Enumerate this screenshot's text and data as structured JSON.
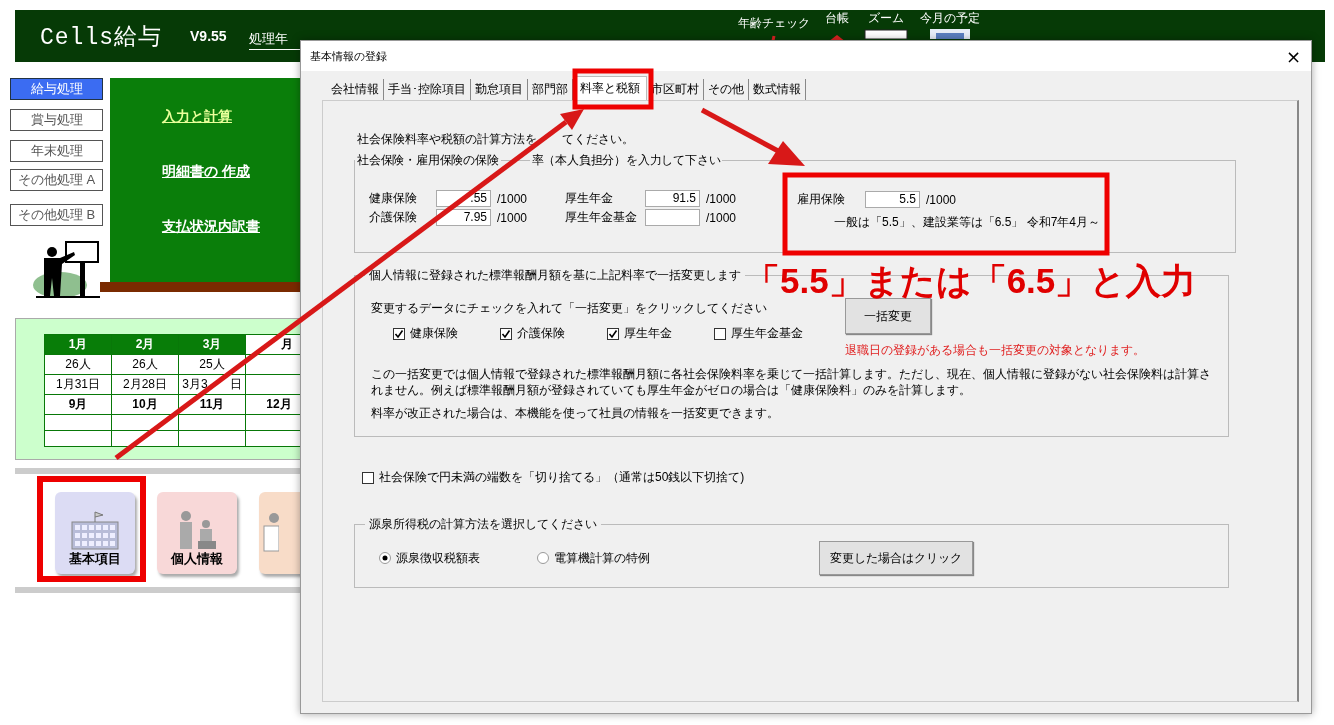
{
  "app": {
    "title": "Cells給与",
    "version": "V9.55",
    "year_label": "処理年",
    "toolbar": [
      {
        "label": "年齢チェック"
      },
      {
        "label": "台帳"
      },
      {
        "label": "ズーム"
      },
      {
        "label": "今月の予定"
      }
    ],
    "menu": [
      {
        "label": "給与処理",
        "selected": true
      },
      {
        "label": "賞与処理",
        "selected": false
      },
      {
        "label": "年末処理",
        "selected": false
      },
      {
        "label": "その他処理 A",
        "selected": false
      },
      {
        "label": "その他処理 B",
        "selected": false
      }
    ],
    "links": [
      {
        "label": "入力と計算",
        "highlight": true
      },
      {
        "label": "明細書の 作成",
        "highlight": false
      },
      {
        "label": "支払状況内訳書",
        "highlight": false
      }
    ],
    "calendar": {
      "header": [
        "1月",
        "2月",
        "3月",
        "月"
      ],
      "rows": [
        [
          "26人",
          "26人",
          "25人",
          ""
        ],
        [
          "1月31日",
          "2月28日",
          [
            "3月3",
            "日"
          ],
          ""
        ]
      ],
      "header_2": [
        "9月",
        "10月",
        "11月",
        "12月"
      ]
    },
    "launchers": [
      {
        "label": "基本項目",
        "kind": "building"
      },
      {
        "label": "個人情報",
        "kind": "people"
      },
      {
        "kind": "worker"
      }
    ]
  },
  "dialog": {
    "title": "基本情報の登録",
    "close": "×",
    "tabs": [
      {
        "label": "会社情報",
        "selected": false
      },
      {
        "label": "手当･控除項目",
        "selected": false
      },
      {
        "label": "勤怠項目",
        "selected": false
      },
      {
        "label": "部門部",
        "selected": false
      },
      {
        "label": "料率と税額",
        "selected": true
      },
      {
        "label": "市区町村",
        "selected": false
      },
      {
        "label": "その他",
        "selected": false
      },
      {
        "label": "数式情報",
        "selected": false
      }
    ],
    "instruction": [
      "社会保険料率や税額の計算方法を",
      "てください。"
    ],
    "rates_group": {
      "legend": [
        "社会保険・雇用保険の保険",
        "率（本人負担分）を入力して下さい"
      ],
      "fields": [
        {
          "label": "健康保険",
          "value": ".55",
          "unit": "/1000"
        },
        {
          "label": "介護保険",
          "value": "7.95",
          "unit": "/1000"
        },
        {
          "label": "厚生年金",
          "value": "91.5",
          "unit": "/1000"
        },
        {
          "label": "厚生年金基金",
          "unit": "/1000"
        }
      ],
      "employment": {
        "label": "雇用保険",
        "value": "5.5",
        "unit": "/1000",
        "note": "一般は「5.5」、建設業等は「6.5」 令和7年4月～"
      }
    },
    "bulk_group": {
      "legend": "個人情報に登録された標準報酬月額を基に上記料率で一括変更します",
      "instruction": "変更するデータにチェックを入れて「一括変更」をクリックしてください",
      "checkboxes": [
        {
          "label": "健康保険",
          "checked": true
        },
        {
          "label": "介護保険",
          "checked": true
        },
        {
          "label": "厚生年金",
          "checked": true
        },
        {
          "label": "厚生年金基金",
          "checked": false
        }
      ],
      "button": "一括変更",
      "warning": "退職日の登録がある場合も一括変更の対象となります。",
      "notes": [
        "この一括変更では個人情報で登録された標準報酬月額に各社会保険料率を乗じて一括計算します。ただし、現在、個人情報に登録がない社会保険料は計算されません。例えば標準報酬月額が登録されていても厚生年金がゼロの場合は「健康保険料」のみを計算します。",
        "料率が改正された場合は、本機能を使って社員の情報を一括変更できます。"
      ]
    },
    "round_down": {
      "label": "社会保険で円未満の端数を「切り捨てる」（通常は50銭以下切捨て)",
      "checked": false
    },
    "tax_group": {
      "legend": "源泉所得税の計算方法を選択してください",
      "options": [
        {
          "label": "源泉徴収税額表",
          "selected": true
        },
        {
          "label": "電算機計算の特例",
          "selected": false
        }
      ],
      "button": "変更した場合はクリック"
    }
  },
  "annotation": {
    "callout": "「5.5」または「6.5」と入力"
  }
}
